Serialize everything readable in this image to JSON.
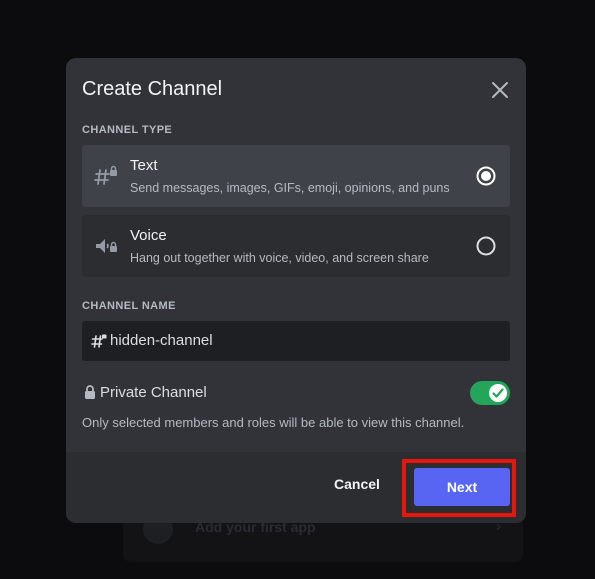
{
  "backdrop": {
    "app_label": "Add your first app"
  },
  "modal": {
    "title": "Create Channel",
    "channel_type_label": "CHANNEL TYPE",
    "options": [
      {
        "title": "Text",
        "description": "Send messages, images, GIFs, emoji, opinions, and puns",
        "icon": "hash-lock-icon",
        "selected": true
      },
      {
        "title": "Voice",
        "description": "Hang out together with voice, video, and screen share",
        "icon": "speaker-lock-icon",
        "selected": false
      }
    ],
    "channel_name_label": "CHANNEL NAME",
    "channel_name_value": "hidden-channel",
    "private_label": "Private Channel",
    "private_enabled": true,
    "private_help": "Only selected members and roles will be able to view this channel.",
    "cancel_label": "Cancel",
    "next_label": "Next"
  },
  "colors": {
    "accent": "#5865f2",
    "toggle_on": "#23a55a",
    "highlight": "#e8170d"
  }
}
